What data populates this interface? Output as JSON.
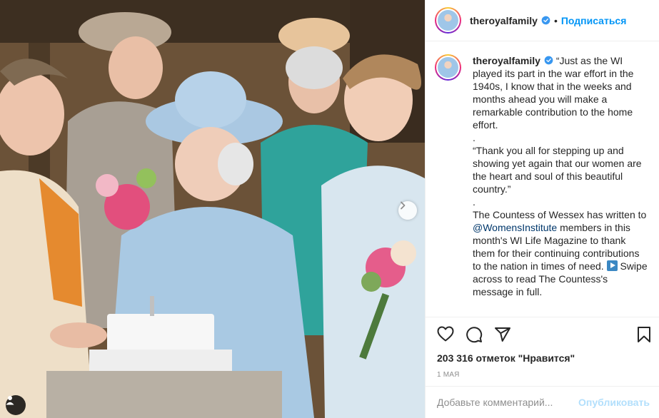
{
  "post": {
    "username": "theroyalfamily",
    "dot": "•",
    "follow_label": "Подписаться",
    "caption": {
      "line1": "“Just as the WI played its part in the war effort in the 1940s, I know that in the weeks and months ahead you will make a remarkable contribution to the home effort.",
      "sep1": ".",
      "line2": "“Thank you all for stepping up and showing yet again that our women are the heart and soul of this beautiful country.”",
      "sep2": ".",
      "line3_before": "The Countess of Wessex has written to ",
      "mention": "@WomensInstitute",
      "line3_after": " members in this month's WI Life Magazine to thank them for their continuing contributions to the nation in times of need.",
      "line3_swipe": " Swipe across to read The Countess's message in full."
    },
    "likes": "203 316 отметок \"Нравится\"",
    "date": "1 МАЯ",
    "comment_placeholder": "Добавьте комментарий...",
    "post_label": "Опубликовать"
  },
  "icons": {
    "verified": "verified-badge-icon",
    "like": "heart-icon",
    "comment": "speech-bubble-icon",
    "share": "paper-plane-icon",
    "save": "bookmark-icon",
    "next": "chevron-right-icon",
    "tag": "user-tag-icon"
  },
  "colors": {
    "accent": "#0095f6",
    "text": "#262626",
    "secondary": "#8e8e8e",
    "link": "#00376b",
    "post_disabled": "#b2dffc"
  }
}
